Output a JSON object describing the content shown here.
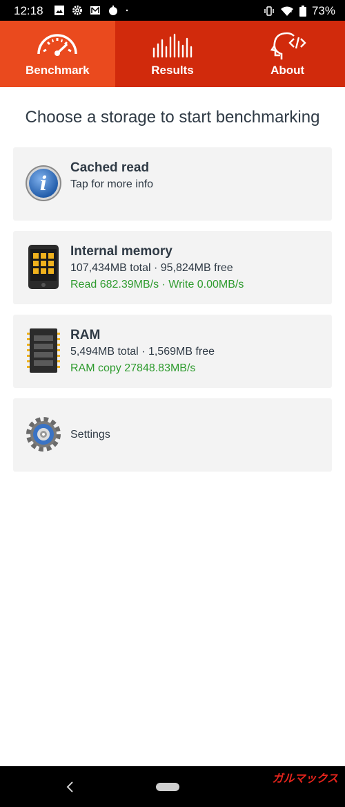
{
  "status": {
    "time": "12:18",
    "battery": "73%",
    "left_icons": [
      "image-icon",
      "gear-icon",
      "mail-icon",
      "android-icon",
      "dot-icon"
    ],
    "right_icons": [
      "vibrate-icon",
      "wifi-icon",
      "battery-icon"
    ]
  },
  "tabs": [
    {
      "label": "Benchmark",
      "icon": "speedometer-icon",
      "active": true
    },
    {
      "label": "Results",
      "icon": "bars-icon",
      "active": false
    },
    {
      "label": "About",
      "icon": "head-code-icon",
      "active": false
    }
  ],
  "heading": "Choose a storage to start benchmarking",
  "cards": {
    "cached": {
      "title": "Cached read",
      "line1": "Tap for more info",
      "icon": "info-icon"
    },
    "internal": {
      "title": "Internal memory",
      "line1": "107,434MB total · 95,824MB free",
      "line2": "Read 682.39MB/s · Write 0.00MB/s",
      "icon": "phone-icon"
    },
    "ram": {
      "title": "RAM",
      "line1": "5,494MB total · 1,569MB free",
      "line2": "RAM copy 27848.83MB/s",
      "icon": "ram-chip-icon"
    },
    "settings": {
      "title": "Settings",
      "icon": "settings-gear-icon"
    }
  },
  "navbar": {
    "watermark": "ガルマックス"
  },
  "colors": {
    "tab_bg": "#d12a0c",
    "tab_active": "#ea4a1e",
    "green": "#2e9b2e",
    "card_bg": "#f3f3f3"
  }
}
